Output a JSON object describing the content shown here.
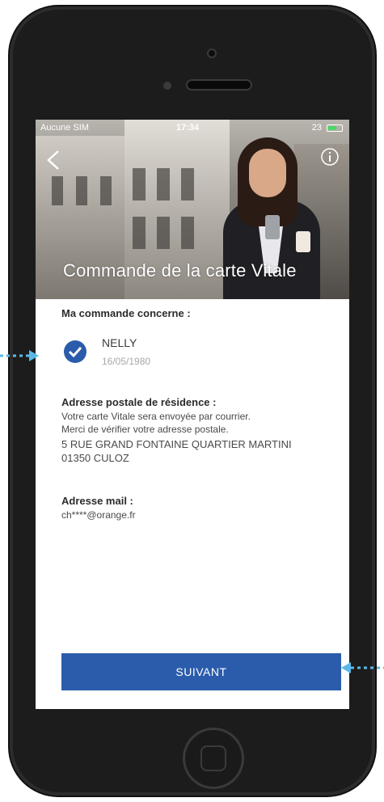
{
  "status_bar": {
    "carrier": "Aucune SIM",
    "time": "17:34",
    "battery_text": "23"
  },
  "header": {
    "title": "Commande de la carte Vitale",
    "back_icon": "chevron-left-icon",
    "info_icon": "info-icon"
  },
  "order": {
    "label": "Ma commande concerne :",
    "name": "NELLY",
    "birthdate": "16/05/1980",
    "check_icon": "checkmark-icon"
  },
  "address": {
    "title": "Adresse postale de résidence :",
    "line1": "Votre carte Vitale sera envoyée par courrier.",
    "line2": "Merci de vérifier votre adresse postale.",
    "line3": "5 RUE GRAND FONTAINE QUARTIER MARTINI",
    "line4": "01350 CULOZ"
  },
  "mail": {
    "title": "Adresse mail :",
    "value": "ch****@orange.fr"
  },
  "actions": {
    "next_label": "SUIVANT"
  },
  "colors": {
    "primary": "#2b5cab",
    "arrow": "#5bb8e6",
    "phone_body": "#1c1c1c"
  }
}
